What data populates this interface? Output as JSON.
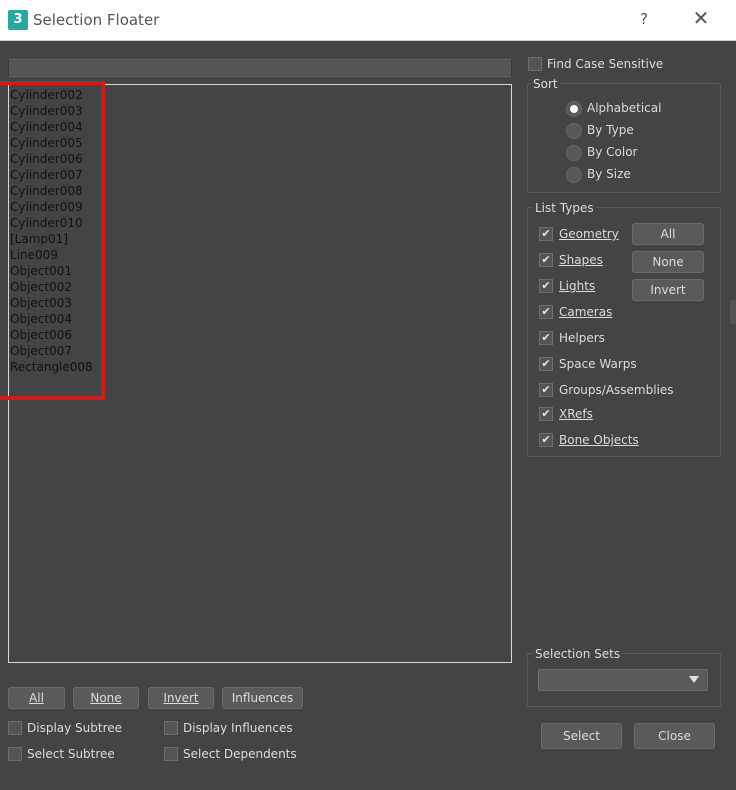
{
  "window": {
    "title": "Selection Floater",
    "app_icon_glyph": "3",
    "help_glyph": "?",
    "close_glyph": "✕"
  },
  "search": {
    "value": ""
  },
  "list": {
    "items": [
      "Cylinder002",
      "Cylinder003",
      "Cylinder004",
      "Cylinder005",
      "Cylinder006",
      "Cylinder007",
      "Cylinder008",
      "Cylinder009",
      "Cylinder010",
      "[Lamp01]",
      "Line009",
      "Object001",
      "Object002",
      "Object003",
      "Object004",
      "Object006",
      "Object007",
      "Rectangle008"
    ]
  },
  "bottom_buttons": [
    {
      "id": "all",
      "label": "All"
    },
    {
      "id": "none",
      "label": "None"
    },
    {
      "id": "invert",
      "label": "Invert"
    },
    {
      "id": "influences",
      "label": "Influences"
    }
  ],
  "bottom_checks": [
    {
      "id": "display-subtree",
      "label": "Display Subtree",
      "checked": false
    },
    {
      "id": "display-influences",
      "label": "Display Influences",
      "checked": false
    },
    {
      "id": "select-subtree",
      "label": "Select Subtree",
      "checked": false
    },
    {
      "id": "select-dependents",
      "label": "Select Dependents",
      "checked": false
    }
  ],
  "find_case": {
    "label": "Find Case Sensitive",
    "checked": false
  },
  "sort": {
    "title": "Sort",
    "options": [
      {
        "label": "Alphabetical",
        "selected": true
      },
      {
        "label": "By Type",
        "selected": false
      },
      {
        "label": "By Color",
        "selected": false
      },
      {
        "label": "By Size",
        "selected": false
      }
    ]
  },
  "list_types": {
    "title": "List Types",
    "items": [
      {
        "label": "Geometry",
        "checked": true
      },
      {
        "label": "Shapes",
        "checked": true
      },
      {
        "label": "Lights",
        "checked": true
      },
      {
        "label": "Cameras",
        "checked": true
      },
      {
        "label": "Helpers",
        "checked": true
      },
      {
        "label": "Space Warps",
        "checked": true
      },
      {
        "label": "Groups/Assemblies",
        "checked": true
      },
      {
        "label": "XRefs",
        "checked": true
      },
      {
        "label": "Bone Objects",
        "checked": true
      }
    ],
    "buttons": [
      "All",
      "None",
      "Invert"
    ]
  },
  "selection_sets": {
    "title": "Selection Sets",
    "value": ""
  },
  "actions": {
    "select": "Select",
    "close": "Close"
  },
  "colors": {
    "panel_bg": "#444444",
    "text": "#dcdcdc",
    "highlight": "#d11a1a"
  }
}
